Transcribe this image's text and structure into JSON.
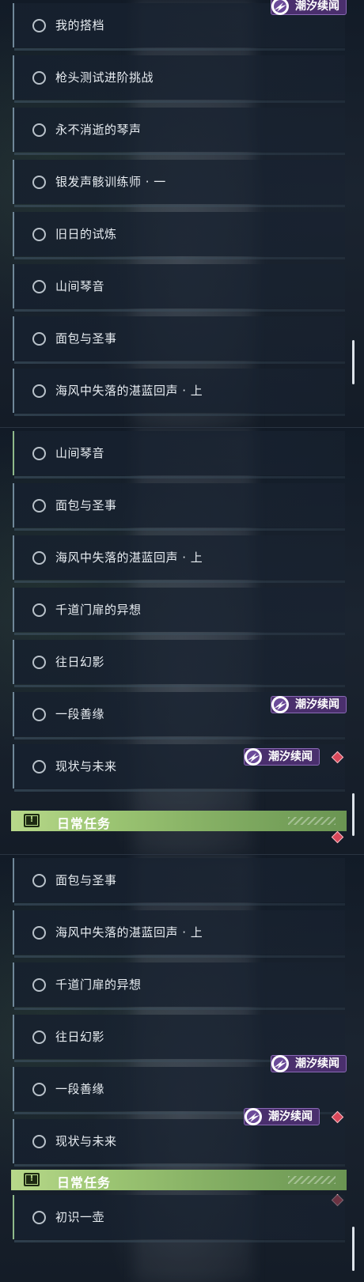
{
  "badge": {
    "label": "潮汐续闻"
  },
  "daily": {
    "title": "日常任务"
  },
  "panel1": {
    "items": [
      "我的搭档",
      "枪头测试进阶挑战",
      "永不消逝的琴声",
      "银发声骸训练师 · 一",
      "旧日的试炼",
      "山间琴音",
      "面包与圣事",
      "海风中失落的湛蓝回声 · 上"
    ]
  },
  "panel2": {
    "items": [
      "山间琴音",
      "面包与圣事",
      "海风中失落的湛蓝回声 · 上",
      "千道门扉的异想",
      "往日幻影",
      "一段善缘",
      "现状与未来"
    ]
  },
  "panel3": {
    "items": [
      "面包与圣事",
      "海风中失落的湛蓝回声 · 上",
      "千道门扉的异想",
      "往日幻影",
      "一段善缘",
      "现状与未来"
    ],
    "daily_items": [
      "初识一壶"
    ]
  },
  "colors": {
    "badge_bg": "#4a2f6d",
    "daily_green": "#9bc472",
    "diamond_red": "#d9485a"
  }
}
